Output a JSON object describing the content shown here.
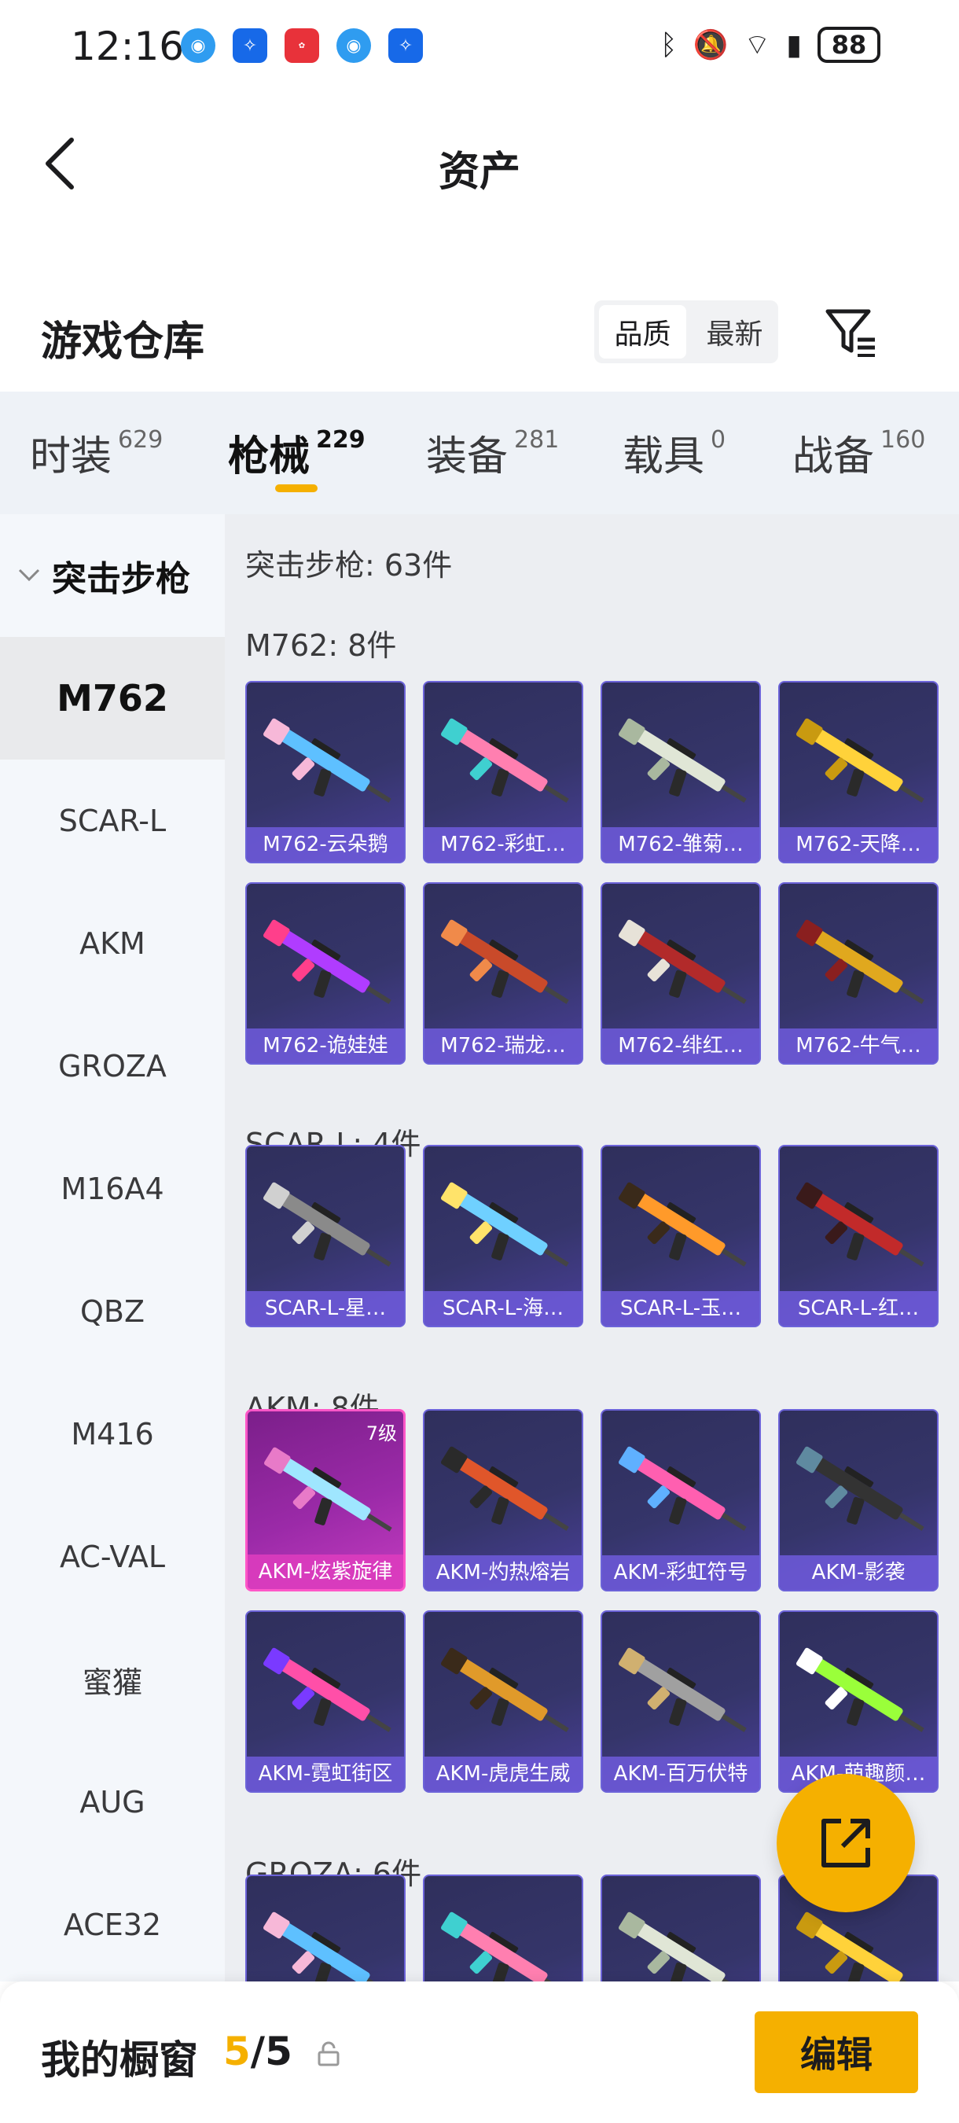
{
  "status_bar": {
    "time": "12:16",
    "battery": "88"
  },
  "nav": {
    "title": "资产"
  },
  "header": {
    "title": "游戏仓库",
    "sort_options": [
      "品质",
      "最新"
    ],
    "active_sort": "品质"
  },
  "tabs": [
    {
      "label": "时装",
      "count": "629"
    },
    {
      "label": "枪械",
      "count": "229",
      "active": true
    },
    {
      "label": "装备",
      "count": "281"
    },
    {
      "label": "载具",
      "count": "0"
    },
    {
      "label": "战备",
      "count": "160"
    }
  ],
  "sidebar": {
    "group": "突击步枪",
    "items": [
      "M762",
      "SCAR-L",
      "AKM",
      "GROZA",
      "M16A4",
      "QBZ",
      "M416",
      "AC-VAL",
      "蜜獾",
      "AUG",
      "ACE32"
    ],
    "active": "M762"
  },
  "main": {
    "summary": "突击步枪: 63件",
    "sections": [
      {
        "title": "M762: 8件",
        "items": [
          "M762-云朵鹅",
          "M762-彩虹…",
          "M762-雏菊…",
          "M762-天降…",
          "M762-诡娃娃",
          "M762-瑞龙…",
          "M762-绯红…",
          "M762-牛气…"
        ]
      },
      {
        "title": "SCAR-L: 4件",
        "items": [
          "SCAR-L-星…",
          "SCAR-L-海…",
          "SCAR-L-玉…",
          "SCAR-L-红…"
        ]
      },
      {
        "title": "AKM: 8件",
        "items": [
          "AKM-炫紫旋律",
          "AKM-灼热熔岩",
          "AKM-彩虹符号",
          "AKM-影袭",
          "AKM-霓虹街区",
          "AKM-虎虎生威",
          "AKM-百万伏特",
          "AKM-萌趣颜…"
        ],
        "badge": "7级"
      },
      {
        "title": "GROZA: 6件",
        "items": []
      }
    ]
  },
  "bottom": {
    "label": "我的橱窗",
    "used": "5",
    "sep": "/",
    "total": "5",
    "edit": "编辑"
  },
  "colors": {
    "accent": "#f5b000",
    "card_bg": "#35356a",
    "card_border": "#6c63d9",
    "special_card": "#9b2aa8"
  },
  "icons": [
    "back-icon",
    "filter-icon",
    "external-link-icon",
    "lock-icon",
    "chevron-down-icon"
  ]
}
